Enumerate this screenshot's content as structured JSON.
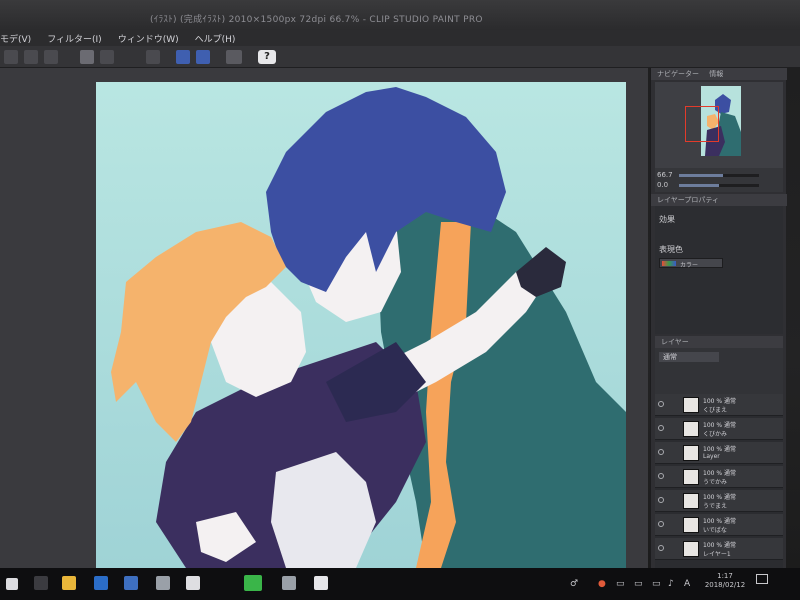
{
  "window": {
    "title": "(ｲﾗｽﾄ) (完成ｲﾗｽﾄ) 2010×1500px 72dpi 66.7% - CLIP STUDIO PAINT PRO"
  },
  "menu": {
    "items": [
      "モデ(V)",
      "フィルター(I)",
      "ウィンドウ(W)",
      "ヘルプ(H)"
    ]
  },
  "toolbar": {
    "help_label": "?"
  },
  "navigator": {
    "tabs": [
      "ナビゲーター",
      "情報"
    ],
    "zoom_value": "66.7",
    "angle_value": "0.0",
    "zoom_fraction": 0.55,
    "angle_fraction": 0.5
  },
  "properties": {
    "tab_label": "レイヤープロパティ",
    "effect_label": "効果",
    "color_label": "表現色",
    "color_value": "カラー"
  },
  "layer_panel": {
    "tab_label": "レイヤー",
    "blend_mode": "通常",
    "layers": [
      {
        "percent": "100 % 通常",
        "name": "くびまえ"
      },
      {
        "percent": "100 % 通常",
        "name": "くびかみ"
      },
      {
        "percent": "100 % 通常",
        "name": "Layer"
      },
      {
        "percent": "100 % 通常",
        "name": "うでかみ"
      },
      {
        "percent": "100 % 通常",
        "name": "うでまえ"
      },
      {
        "percent": "100 % 通常",
        "name": "いでばな"
      },
      {
        "percent": "100 % 通常",
        "name": "レイヤー1"
      }
    ]
  },
  "taskbar": {
    "time": "1:17",
    "date": "2018/02/12",
    "ime": "A"
  },
  "colors": {
    "canvas_bg_top": "#b9e6e2",
    "canvas_bg_bottom": "#9fd3d6",
    "hair_blue": "#3c4fa2",
    "hair_orange": "#f5b36c",
    "jacket_teal": "#2f6d70",
    "jacket_dark": "#3b2f5f",
    "skin": "#f4f1f2",
    "scarf": "#f6a35a",
    "frame_red": "#e23b2b"
  },
  "icons": {
    "title": "clip-studio-icon",
    "taskbar": [
      "windows-start-icon",
      "task-view-icon",
      "file-explorer-icon",
      "edge-icon",
      "store-icon",
      "app-icon",
      "clip-studio-taskbar-icon",
      "line-icon",
      "camera-icon",
      "clip-studio-paint-icon"
    ]
  }
}
